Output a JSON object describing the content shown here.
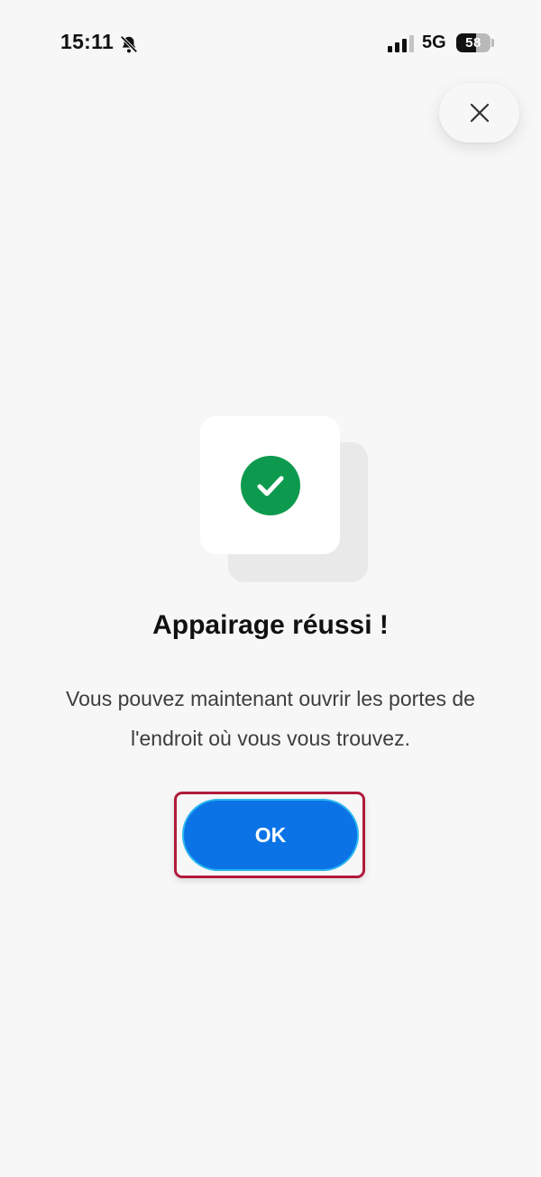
{
  "status_bar": {
    "time": "15:11",
    "network": "5G",
    "battery_level": "58",
    "icons": [
      "bell-slash-icon",
      "signal-icon",
      "battery-icon"
    ]
  },
  "close_button": {
    "icon": "close-icon"
  },
  "illustration": {
    "icon": "check-circle-icon",
    "accent_color": "#0e9a4e"
  },
  "dialog": {
    "title": "Appairage réussi !",
    "description": "Vous pouvez maintenant ouvrir les portes de l'endroit où vous vous trouvez.",
    "ok_label": "OK",
    "ok_color": "#0b73e6",
    "highlight_color": "#b11a3b"
  }
}
